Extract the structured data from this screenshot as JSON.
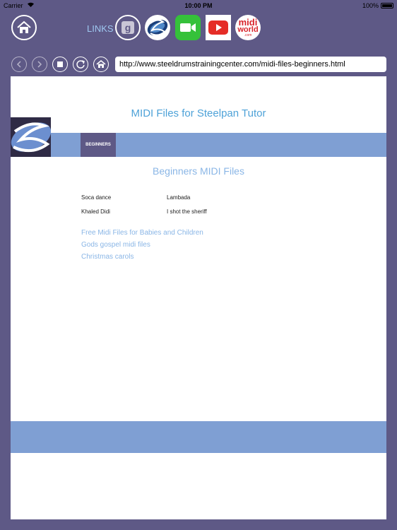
{
  "status_bar": {
    "carrier": "Carrier",
    "time": "10:00 PM",
    "battery": "100%"
  },
  "toolbar": {
    "links_label": "LINKS",
    "midiworld_line1": "midi",
    "midiworld_line2": "world",
    "midiworld_line3": ".com"
  },
  "nav": {
    "url": "http://www.steeldrumstrainingcenter.com/midi-files-beginners.html"
  },
  "page": {
    "title": "MIDI Files for Steelpan Tutor",
    "menu_tab": "BEGINNERS",
    "heading": "Beginners MIDI Files",
    "songs": [
      "Soca dance",
      "Lambada",
      "Khaled Didi",
      "I shot the sheriff"
    ],
    "links": [
      "Free Midi Files for Babies and Children",
      "Gods gospel midi files",
      "Christmas carols"
    ]
  },
  "colors": {
    "background": "#5e5986",
    "accent_blue": "#7f9fd3",
    "link_blue": "#8ab6e6",
    "title_blue": "#4ea2d8"
  }
}
